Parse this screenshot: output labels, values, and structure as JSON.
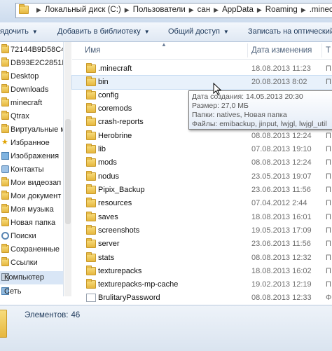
{
  "address": {
    "crumbs": [
      "Локальный диск (C:)",
      "Пользователи",
      "сан",
      "AppData",
      "Roaming",
      ".minec"
    ]
  },
  "toolbar": {
    "organize": "ядочить",
    "add_library": "Добавить в библиотеку",
    "share": "Общий доступ",
    "burn": "Записать на оптический"
  },
  "sidebar": {
    "items": [
      {
        "label": "72144B9D58C4",
        "icon": "folder-icon"
      },
      {
        "label": "DB93E2C2851F",
        "icon": "folder-icon"
      },
      {
        "label": "Desktop",
        "icon": "folder-icon"
      },
      {
        "label": "Downloads",
        "icon": "folder-icon"
      },
      {
        "label": "minecraft",
        "icon": "folder-icon"
      },
      {
        "label": "Qtrax",
        "icon": "folder-icon"
      },
      {
        "label": "Виртуальные м",
        "icon": "folder-icon"
      },
      {
        "label": "Избранное",
        "icon": "star-icon"
      },
      {
        "label": "Изображения",
        "icon": "pictures-icon"
      },
      {
        "label": "Контакты",
        "icon": "contacts-icon"
      },
      {
        "label": "Мои видеозап",
        "icon": "folder-icon"
      },
      {
        "label": "Мои документ",
        "icon": "folder-icon"
      },
      {
        "label": "Моя музыка",
        "icon": "folder-icon"
      },
      {
        "label": "Новая папка",
        "icon": "folder-icon"
      },
      {
        "label": "Поиски",
        "icon": "search-icon"
      },
      {
        "label": "Сохраненные",
        "icon": "folder-icon"
      },
      {
        "label": "Ссылки",
        "icon": "folder-icon"
      },
      {
        "label": "Компьютер",
        "icon": "computer-icon"
      },
      {
        "label": "Сеть",
        "icon": "network-icon"
      }
    ]
  },
  "columns": {
    "name": "Имя",
    "date": "Дата изменения",
    "type": "Т"
  },
  "files": [
    {
      "name": ".minecraft",
      "date": "18.08.2013 11:23",
      "type": "П",
      "kind": "folder"
    },
    {
      "name": "bin",
      "date": "20.08.2013 8:02",
      "type": "П",
      "kind": "folder"
    },
    {
      "name": "config",
      "date": "",
      "type": "",
      "kind": "folder"
    },
    {
      "name": "coremods",
      "date": "",
      "type": "",
      "kind": "folder"
    },
    {
      "name": "crash-reports",
      "date": "",
      "type": "",
      "kind": "folder"
    },
    {
      "name": "Herobrine",
      "date": "08.08.2013 12:24",
      "type": "П",
      "kind": "folder"
    },
    {
      "name": "lib",
      "date": "07.08.2013 19:10",
      "type": "П",
      "kind": "folder"
    },
    {
      "name": "mods",
      "date": "08.08.2013 12:24",
      "type": "П",
      "kind": "folder"
    },
    {
      "name": "nodus",
      "date": "23.05.2013 19:07",
      "type": "П",
      "kind": "folder"
    },
    {
      "name": "Pipix_Backup",
      "date": "23.06.2013 11:56",
      "type": "П",
      "kind": "folder"
    },
    {
      "name": "resources",
      "date": "07.04.2012 2:44",
      "type": "П",
      "kind": "folder"
    },
    {
      "name": "saves",
      "date": "18.08.2013 16:01",
      "type": "П",
      "kind": "folder"
    },
    {
      "name": "screenshots",
      "date": "19.05.2013 17:09",
      "type": "П",
      "kind": "folder"
    },
    {
      "name": "server",
      "date": "23.06.2013 11:56",
      "type": "П",
      "kind": "folder"
    },
    {
      "name": "stats",
      "date": "08.08.2013 12:32",
      "type": "П",
      "kind": "folder"
    },
    {
      "name": "texturepacks",
      "date": "18.08.2013 16:02",
      "type": "П",
      "kind": "folder"
    },
    {
      "name": "texturepacks-mp-cache",
      "date": "19.02.2013 12:19",
      "type": "П",
      "kind": "folder"
    },
    {
      "name": "BrulitaryPassword",
      "date": "08.08.2013 12:33",
      "type": "Ф",
      "kind": "file"
    }
  ],
  "tooltip": {
    "created": "Дата создания: 14.05.2013 20:30",
    "size": "Размер: 27,0 МБ",
    "folders": "Папки: natives, Новая папка",
    "files": "Файлы: emibackup, jinput, lwjgl, lwjgl_util"
  },
  "status": {
    "items_label": "Элементов:",
    "items_count": "46"
  },
  "colors": {
    "folder": "#e6b73e",
    "toolbar_text": "#1e395b",
    "selection": "#d9e6f6"
  }
}
